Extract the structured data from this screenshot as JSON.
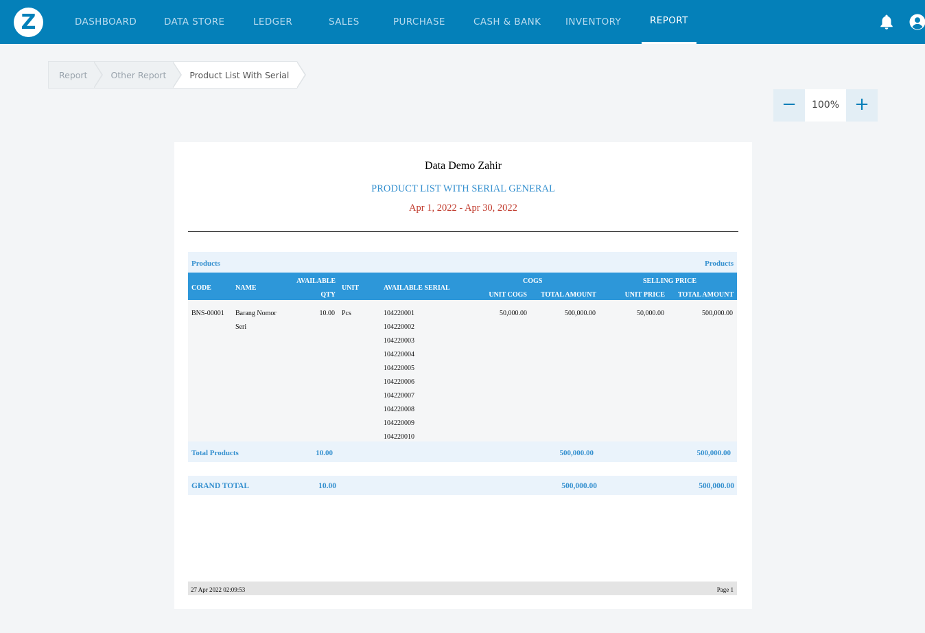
{
  "nav": {
    "logo": "Z",
    "items": [
      "DASHBOARD",
      "DATA STORE",
      "LEDGER",
      "SALES",
      "PURCHASE",
      "CASH & BANK",
      "INVENTORY",
      "REPORT"
    ],
    "active": "REPORT"
  },
  "breadcrumb": [
    "Report",
    "Other Report",
    "Product List With Serial"
  ],
  "zoom": {
    "minus": "−",
    "value": "100%",
    "plus": "+"
  },
  "report": {
    "company": "Data Demo Zahir",
    "title": "PRODUCT LIST WITH SERIAL GENERAL",
    "period": "Apr 1, 2022 - Apr 30, 2022",
    "group_label_left": "Products",
    "group_label_right": "Products",
    "headers": {
      "code": "CODE",
      "name": "NAME",
      "available": "AVAILABLE",
      "qty": "QTY",
      "unit": "UNIT",
      "available_serial": "AVAILABLE SERIAL",
      "cogs": "COGS",
      "unit_cogs": "UNIT COGS",
      "cogs_total": "TOTAL AMOUNT",
      "selling_price": "SELLING PRICE",
      "unit_price": "UNIT PRICE",
      "selling_total": "TOTAL AMOUNT"
    },
    "row": {
      "code": "BNS-00001",
      "name_line1": "Barang Nomor",
      "name_line2": "Seri",
      "qty": "10.00",
      "unit": "Pcs",
      "serials": [
        "104220001",
        "104220002",
        "104220003",
        "104220004",
        "104220005",
        "104220006",
        "104220007",
        "104220008",
        "104220009",
        "104220010"
      ],
      "unit_cogs": "50,000.00",
      "cogs_total": "500,000.00",
      "unit_price": "50,000.00",
      "selling_total": "500,000.00"
    },
    "total": {
      "label": "Total Products",
      "qty": "10.00",
      "cogs_total": "500,000.00",
      "selling_total": "500,000.00"
    },
    "grand_total": {
      "label": "GRAND TOTAL",
      "qty": "10.00",
      "cogs_total": "500,000.00",
      "selling_total": "500,000.00"
    },
    "footer": {
      "printed": "27 Apr 2022 02:09:53",
      "page": "Page 1"
    }
  }
}
